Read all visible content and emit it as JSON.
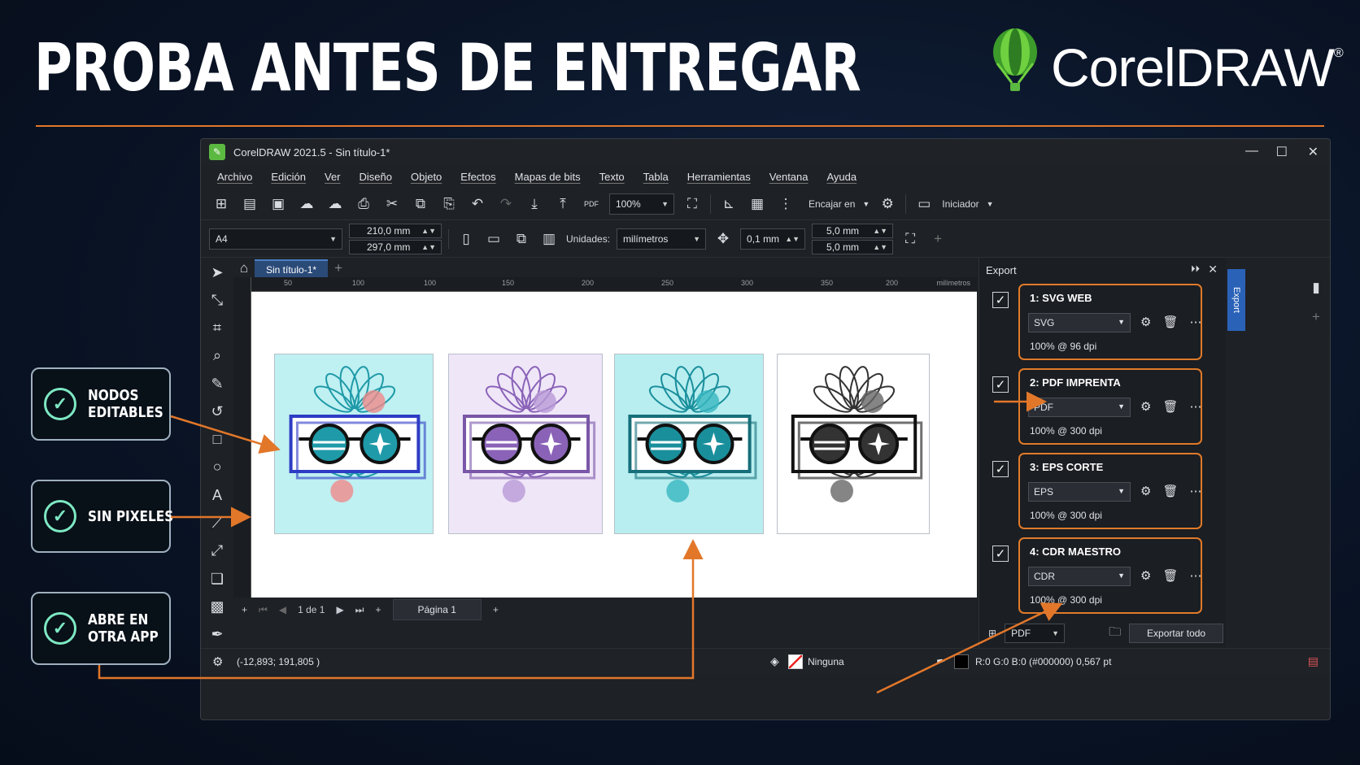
{
  "headline": "PROBA ANTES DE ENTREGAR",
  "brand": {
    "name": "CorelDRAW",
    "mark": "®",
    "accent": "#e2772a",
    "logo_green": "#5bb840"
  },
  "features": [
    {
      "line1": "NODOS",
      "line2": "EDITABLES"
    },
    {
      "line1": "SIN PIXELES",
      "line2": ""
    },
    {
      "line1": "ABRE EN",
      "line2": "OTRA APP"
    }
  ],
  "window": {
    "title": "CorelDRAW 2021.5 - Sin título-1*",
    "menu": [
      "Archivo",
      "Edición",
      "Ver",
      "Diseño",
      "Objeto",
      "Efectos",
      "Mapas de bits",
      "Texto",
      "Tabla",
      "Herramientas",
      "Ventana",
      "Ayuda"
    ],
    "zoom": "100%",
    "snap_label": "Encajar en",
    "launcher_label": "Iniciador",
    "page_size": "A4",
    "width": "210,0 mm",
    "height": "297,0 mm",
    "units_label": "Unidades:",
    "units_value": "milímetros",
    "nudge": "0,1 mm",
    "dup_x": "5,0 mm",
    "dup_y": "5,0 mm",
    "doc_tab": "Sin título-1*",
    "ruler_ticks": [
      "50",
      "100",
      "150",
      "200",
      "250",
      "300",
      "350",
      "200"
    ],
    "ruler_unit": "milímetros",
    "page_counter": "1 de 1",
    "page_tab": "Página 1",
    "status": {
      "coords": "(-12,893; 191,805 )",
      "fill": "Ninguna",
      "outline": "R:0 G:0 B:0 (#000000) 0,567 pt"
    }
  },
  "export_panel": {
    "title": "Export",
    "side_tab": "Export",
    "items": [
      {
        "name": "1: SVG WEB",
        "format": "SVG",
        "dpi": "100% @ 96 dpi"
      },
      {
        "name": "2: PDF IMPRENTA",
        "format": "PDF",
        "dpi": "100% @ 300 dpi"
      },
      {
        "name": "3: EPS CORTE",
        "format": "EPS",
        "dpi": "100% @ 300 dpi"
      },
      {
        "name": "4: CDR MAESTRO",
        "format": "CDR",
        "dpi": "100% @ 300 dpi"
      }
    ],
    "bottom_format": "PDF",
    "export_all": "Exportar todo"
  },
  "cards": [
    {
      "bg": "#bff0f2",
      "accent": "#1f9aa8",
      "frame": "#2d3cc4",
      "flower": "#f08a8a"
    },
    {
      "bg": "#efe6f8",
      "accent": "#8a63b8",
      "frame": "#7a57a8",
      "flower": "#b89ad6"
    },
    {
      "bg": "#b8eef0",
      "accent": "#1a8f9c",
      "frame": "#166f7a",
      "flower": "#38b7c0"
    },
    {
      "bg": "#ffffff",
      "accent": "#333333",
      "frame": "#111111",
      "flower": "#666666"
    }
  ]
}
